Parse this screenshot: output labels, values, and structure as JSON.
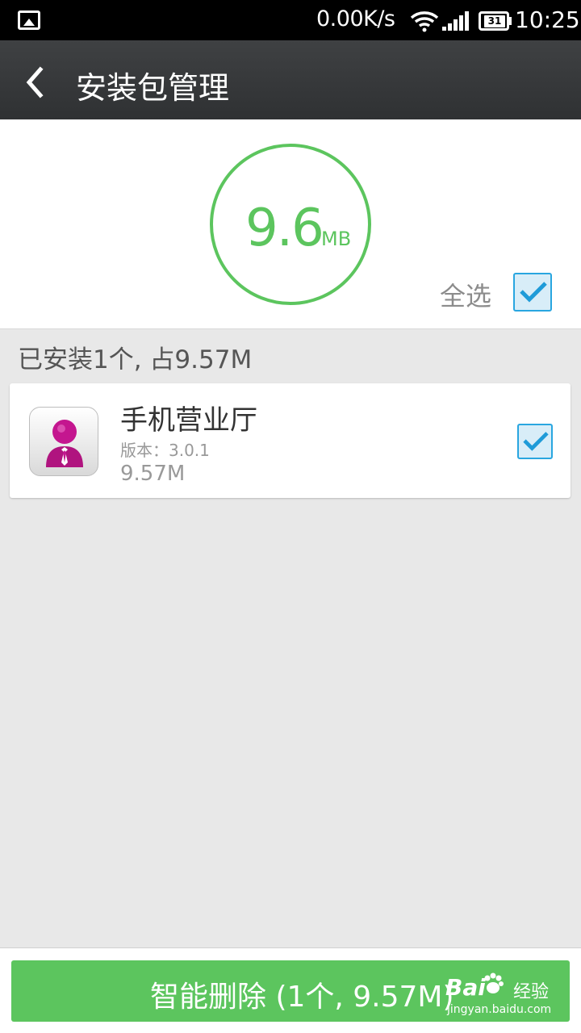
{
  "status_bar": {
    "network_speed": "0.00K/s",
    "battery_level": "31",
    "time": "10:25",
    "icons": [
      "gallery-notification-icon",
      "wifi-icon",
      "signal-icon",
      "battery-icon"
    ]
  },
  "header": {
    "title": "安装包管理",
    "back_icon": "chevron-left-icon"
  },
  "summary": {
    "total_size": "9.6",
    "unit": "MB",
    "select_all_label": "全选",
    "select_all_checked": true,
    "accent_color": "#5cc55e"
  },
  "section": {
    "title": "已安装1个, 占9.57M"
  },
  "apps": [
    {
      "name": "手机营业厅",
      "version": "版本：3.0.1",
      "size": "9.57M",
      "checked": true,
      "icon": "business-person-icon"
    }
  ],
  "actions": {
    "delete_label": "智能删除 (1个, 9.57M)"
  },
  "watermark": {
    "brand": "Bai",
    "cn": "经验",
    "url": "jingyan.baidu.com"
  }
}
